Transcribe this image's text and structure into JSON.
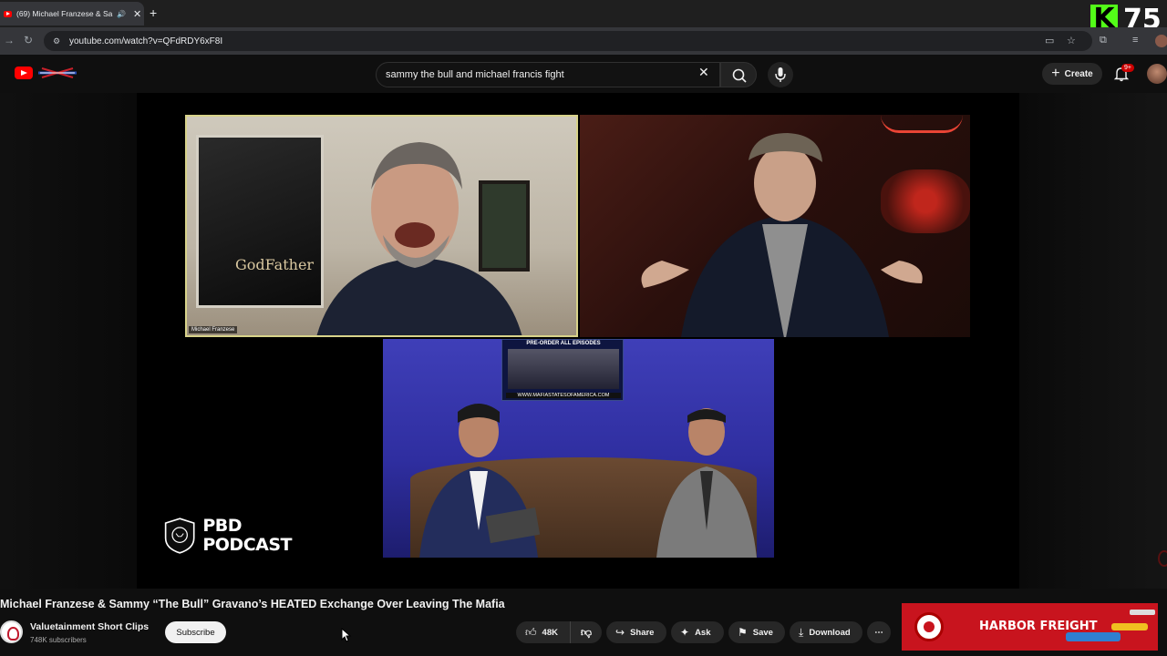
{
  "browser": {
    "tab_title": "(69) Michael Franzese & Sa",
    "url": "youtube.com/watch?v=QFdRDY6xF8I",
    "kick_badge": {
      "letter": "K",
      "count": "75"
    }
  },
  "youtube": {
    "search": {
      "value": "sammy the bull and michael francis fight"
    },
    "create_label": "Create",
    "notifications_badge": "9+"
  },
  "video": {
    "cam1_name_label": "Michael Franzese",
    "poster_text": "GodFather",
    "banner_top": "PRE-ORDER ALL EPISODES",
    "banner_url": "WWW.MAFIASTATESOFAMERICA.COM",
    "watermark_line1": "PBD",
    "watermark_line2": "PODCAST"
  },
  "details": {
    "title": "Michael Franzese & Sammy “The Bull” Gravano’s HEATED Exchange Over Leaving The Mafia",
    "channel_name": "Valuetainment Short Clips",
    "subscribers": "748K subscribers",
    "subscribe_label": "Subscribe",
    "like_count": "48K",
    "share_label": "Share",
    "ask_label": "Ask",
    "save_label": "Save",
    "download_label": "Download"
  },
  "ad": {
    "text": "HARBOR FREIGHT"
  },
  "colors": {
    "accent": "#ff0000",
    "kick_green": "#53fc18",
    "ad_red": "#c8141e"
  }
}
